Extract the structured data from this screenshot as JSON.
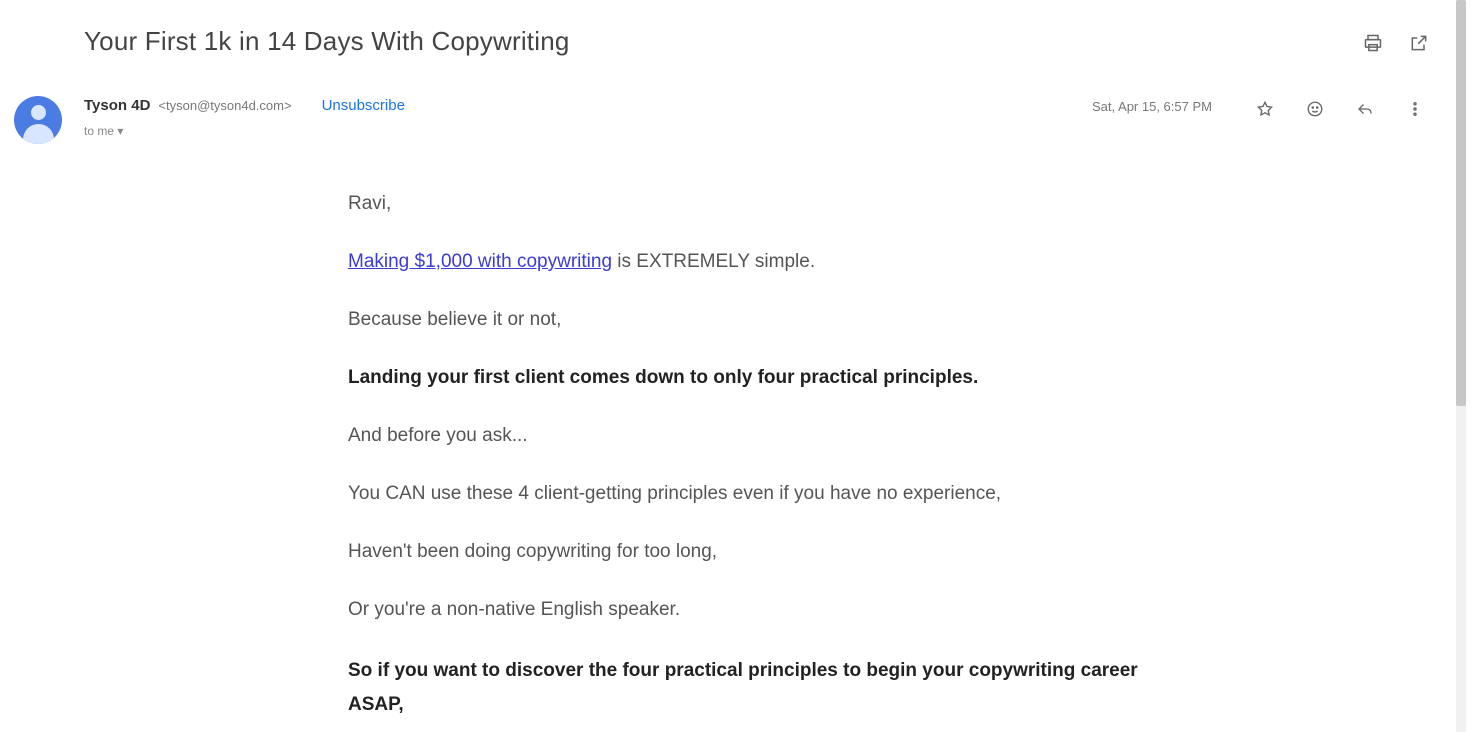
{
  "email": {
    "subject": "Your First 1k in 14 Days With Copywriting",
    "sender": {
      "name": "Tyson 4D",
      "email": "<tyson@tyson4d.com>",
      "unsubscribe_label": "Unsubscribe",
      "to": "to me ▾"
    },
    "date": "Sat, Apr 15, 6:57 PM",
    "greeting": "Ravi,",
    "p1_link": "Making $1,000 with copywriting",
    "p1_rest": " is EXTREMELY simple.",
    "p2": "Because believe it or not,",
    "p3": "Landing your first client comes down to only four practical principles.",
    "p4": "And before you ask...",
    "p5": "You CAN use these 4 client-getting principles even if you have no experience,",
    "p6": "Haven't been doing copywriting for too long,",
    "p7": "Or you're a non-native English speaker.",
    "p8": "So if you want to discover the four practical principles to begin your copywriting career ASAP,"
  },
  "icons": {
    "top": [
      "print-icon",
      "open-in-new-window-icon"
    ],
    "message": [
      "star-icon",
      "emoji-icon",
      "reply-icon",
      "more-options-icon"
    ]
  },
  "colors": {
    "link": "#3b3bd6",
    "unsubscribe": "#1a73e8",
    "avatar": "#4a7ce3"
  }
}
